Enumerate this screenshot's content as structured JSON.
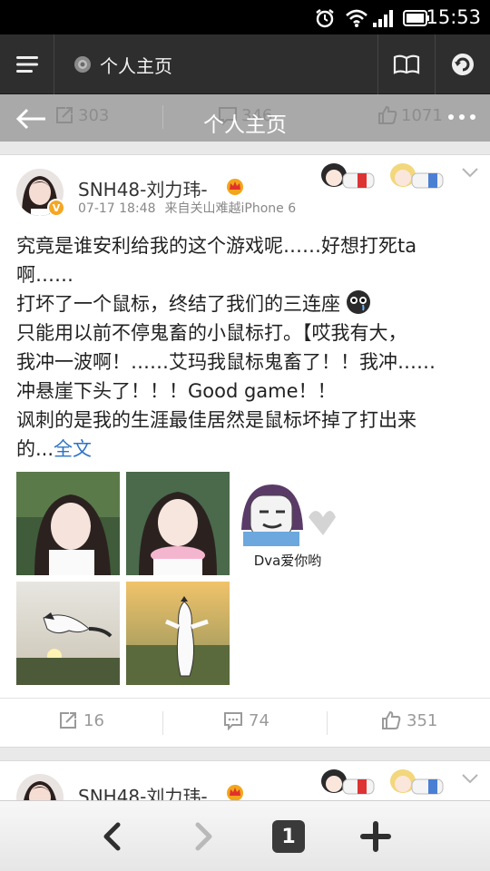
{
  "status_bar": {
    "time": "15:53"
  },
  "browser": {
    "url_title": "个人主页"
  },
  "page_header": {
    "title": "个人主页",
    "ghost_repost": "303",
    "ghost_comment": "346",
    "ghost_like": "1071"
  },
  "posts": [
    {
      "user_name": "SNH48-刘力玮-",
      "date": "07-17 18:48",
      "source": "来自关山难越iPhone 6",
      "text_lines": [
        "究竟是谁安利给我的这个游戏呢……好想打死ta",
        "啊……",
        "打坏了一个鼠标，终结了我们的三连座",
        "只能用以前不停鬼畜的小鼠标打。【哎我有大，",
        "我冲一波啊！……艾玛我鼠标鬼畜了！！我冲……",
        "冲悬崖下头了！！！Good game！！",
        "讽刺的是我的生涯最佳居然是鼠标坏掉了打出来",
        "的..."
      ],
      "full_text_link": "全文",
      "image_caption": "Dva爱你哟",
      "reposts": "16",
      "comments": "74",
      "likes": "351"
    },
    {
      "user_name": "SNH48-刘力玮-"
    }
  ],
  "bottom_nav": {
    "tab_count": "1"
  },
  "colors": {
    "link": "#2e73c4",
    "toolbar": "#2e2e2e",
    "badge": "#f5a623"
  }
}
